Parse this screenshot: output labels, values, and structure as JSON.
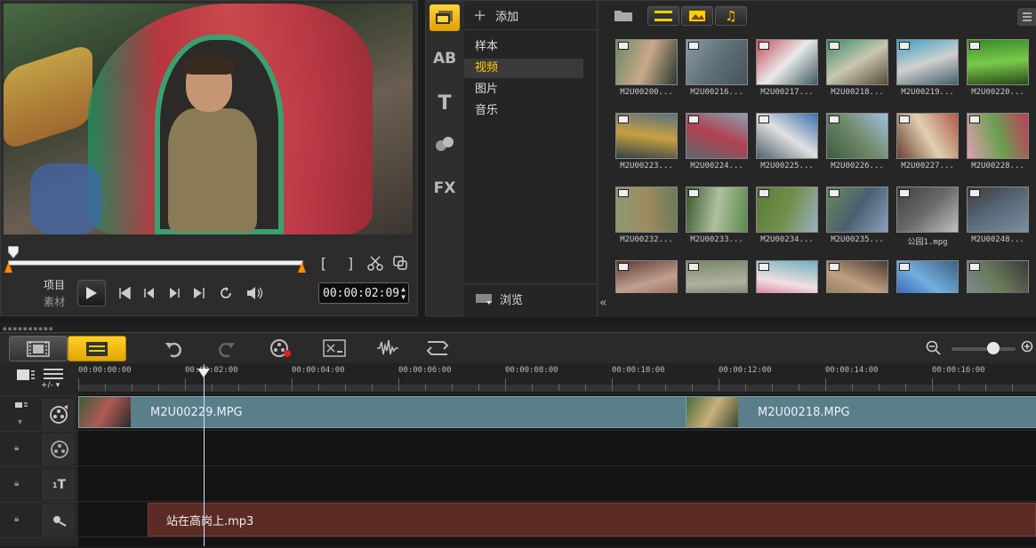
{
  "preview": {
    "project_label": "项目",
    "clip_label": "素材",
    "timecode": "00:00:02:09",
    "mark_in": "[",
    "mark_out": "]"
  },
  "library": {
    "add_label": "添加",
    "nav_items": [
      "样本",
      "视频",
      "图片",
      "音乐"
    ],
    "active_nav": "视频",
    "browse_label": "浏览",
    "tabs": [
      "media-icon",
      "transition-icon",
      "title-icon",
      "graphics-icon",
      "filter-icon"
    ],
    "tab_labels": [
      "",
      "AB",
      "T",
      "",
      "FX"
    ],
    "thumbnails": [
      "M2U00200...",
      "M2U00216...",
      "M2U00217...",
      "M2U00218...",
      "M2U00219...",
      "M2U00220...",
      "M2U00223...",
      "M2U00224...",
      "M2U00225...",
      "M2U00226...",
      "M2U00227...",
      "M2U00228...",
      "M2U00232...",
      "M2U00233...",
      "M2U00234...",
      "M2U00235...",
      "公园1.mpg",
      "M2U00248...",
      "",
      "",
      "",
      "",
      "",
      ""
    ]
  },
  "timeline": {
    "ruler_labels": [
      "00:00:00:00",
      "00:00:02:00",
      "00:00:04:00",
      "00:00:06:00",
      "00:00:08:00",
      "00:00:10:00",
      "00:00:12:00",
      "00:00:14:00",
      "00:00:16:00"
    ],
    "add_remove_label": "+/-",
    "video_clips": [
      "M2U00229.MPG",
      "M2U00218.MPG"
    ],
    "audio_clip": "站在高岗上.mp3"
  },
  "colors": {
    "accent": "#ffd000",
    "video_clip": "#5a7f88",
    "audio_clip": "#5c2b26",
    "trim_marker": "#ff8a00"
  }
}
